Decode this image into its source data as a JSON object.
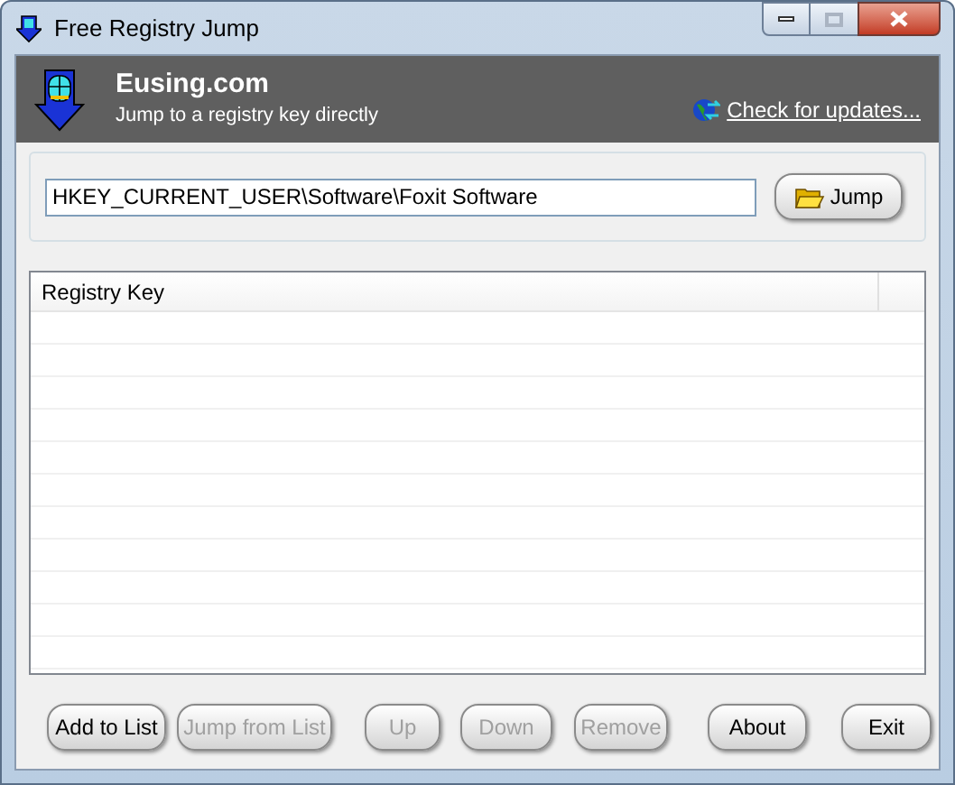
{
  "window": {
    "title": "Free Registry Jump"
  },
  "header": {
    "title": "Eusing.com",
    "subtitle": "Jump to a registry key directly",
    "link": "Check for updates..."
  },
  "path_field": {
    "value": "HKEY_CURRENT_USER\\Software\\Foxit Software"
  },
  "jump_button": {
    "label": "Jump"
  },
  "table": {
    "columns": [
      "Registry Key"
    ]
  },
  "buttons": [
    {
      "label": "Add to List",
      "disabled": false
    },
    {
      "label": "Jump from List",
      "disabled": true
    },
    {
      "label": "Up",
      "disabled": true
    },
    {
      "label": "Down",
      "disabled": true
    },
    {
      "label": "Remove",
      "disabled": true
    },
    {
      "label": "About",
      "disabled": false
    },
    {
      "label": "Exit",
      "disabled": false
    }
  ]
}
